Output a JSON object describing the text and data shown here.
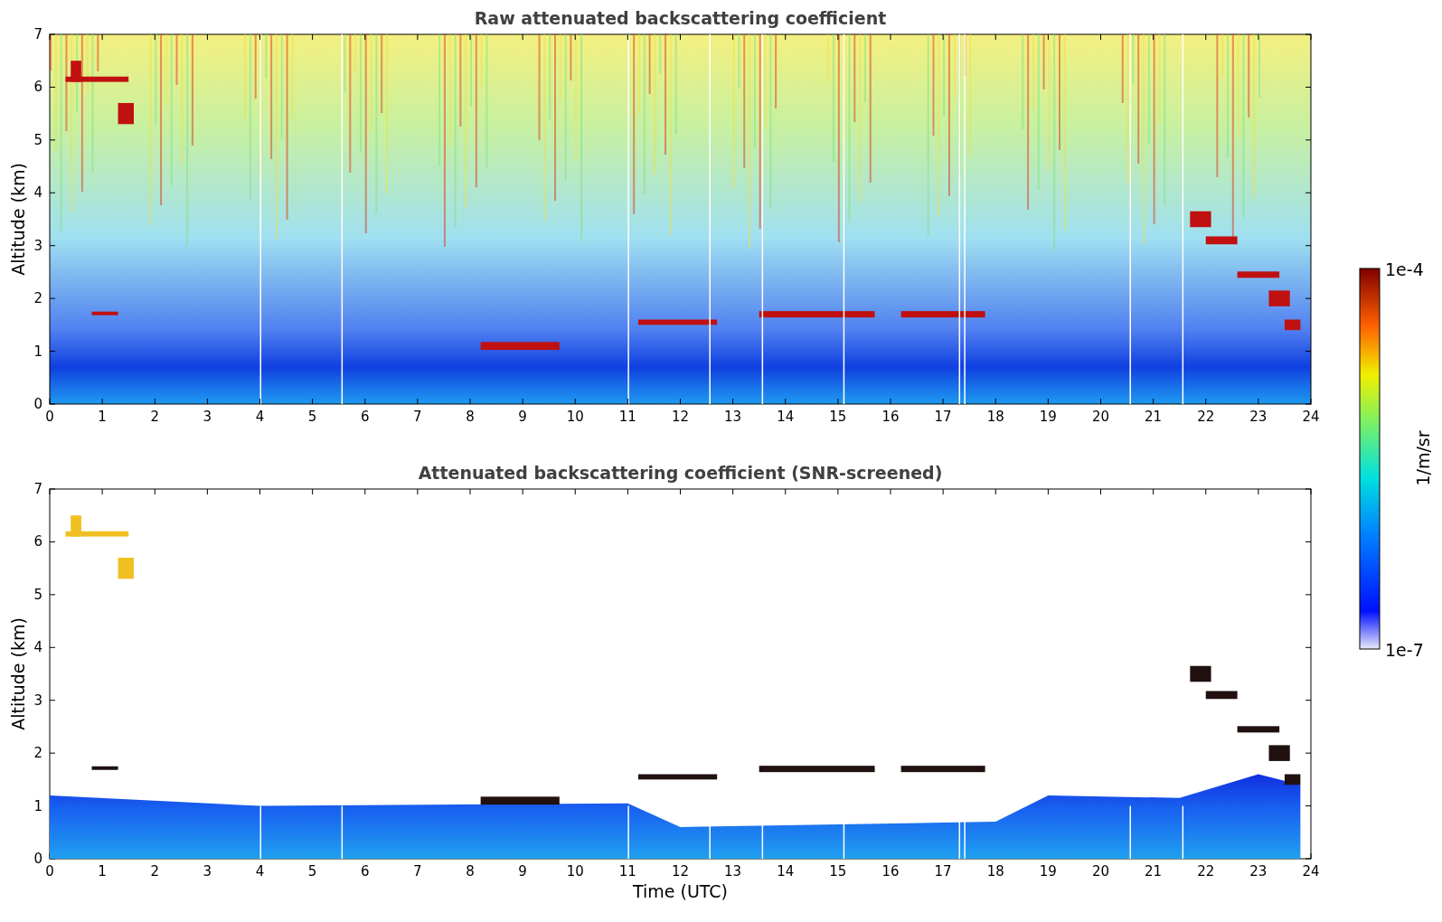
{
  "figure": {
    "panels": [
      {
        "kind": "raw",
        "title": "Raw attenuated backscattering coefficient",
        "ylabel": "Altitude (km)",
        "yticks": [
          "7",
          "6",
          "5",
          "4",
          "3",
          "2",
          "1",
          "0"
        ],
        "xticks": [
          "0",
          "1",
          "2",
          "3",
          "4",
          "5",
          "6",
          "7",
          "8",
          "9",
          "10",
          "11",
          "12",
          "13",
          "14",
          "15",
          "16",
          "17",
          "18",
          "19",
          "20",
          "21",
          "22",
          "23",
          "24"
        ]
      },
      {
        "kind": "screened",
        "title": "Attenuated backscattering coefficient (SNR-screened)",
        "ylabel": "Altitude (km)",
        "xlabel": "Time (UTC)",
        "yticks": [
          "7",
          "6",
          "5",
          "4",
          "3",
          "2",
          "1",
          "0"
        ],
        "xticks": [
          "0",
          "1",
          "2",
          "3",
          "4",
          "5",
          "6",
          "7",
          "8",
          "9",
          "10",
          "11",
          "12",
          "13",
          "14",
          "15",
          "16",
          "17",
          "18",
          "19",
          "20",
          "21",
          "22",
          "23",
          "24"
        ]
      }
    ],
    "colorbar": {
      "max_label": "1e-4",
      "min_label": "1e-7",
      "unit": "1/m/sr"
    }
  }
}
